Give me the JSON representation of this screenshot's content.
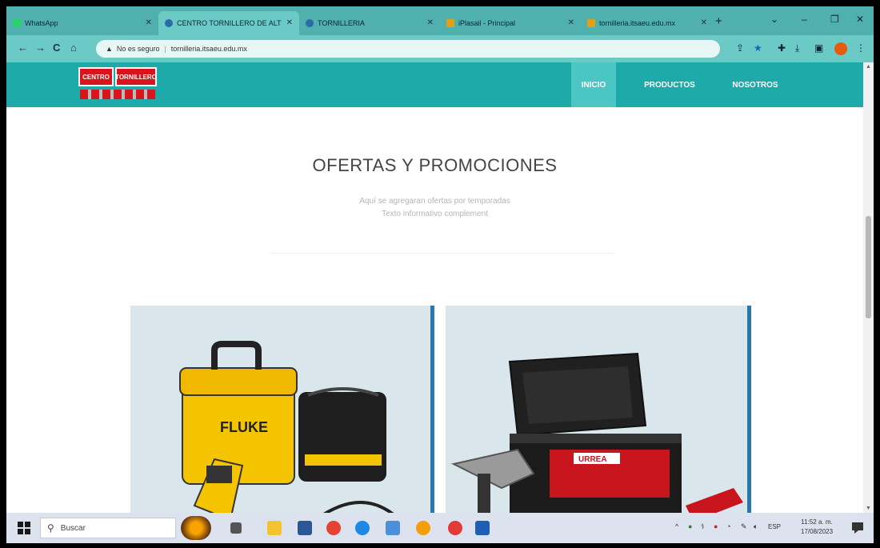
{
  "browser": {
    "tabs": [
      {
        "label": "WhatsApp",
        "color": "#25d366"
      },
      {
        "label": "CENTRO TORNILLERO DE ALT",
        "color": "#2a6ba8"
      },
      {
        "label": "TORNILLERIA",
        "color": "#2a6ba8"
      },
      {
        "label": "iPlasail - Principal",
        "color": "#e0a11b"
      },
      {
        "label": "tornilleria.itsaeu.edu.mx",
        "color": "#e0a11b"
      }
    ],
    "new_tab": "+",
    "window_controls": {
      "minimize": "–",
      "maximize": "❐",
      "close": "✕"
    },
    "nav": {
      "back": "←",
      "forward": "→",
      "reload": "C",
      "home": "⌂"
    },
    "address": {
      "security_label": "No es seguro",
      "url": "tornilleria.itsaeu.edu.mx"
    }
  },
  "site": {
    "logo": {
      "part1": "CENTRO",
      "part2": "TORNILLERO"
    },
    "nav": [
      {
        "label": "INICIO",
        "active": true
      },
      {
        "label": "PRODUCTOS",
        "active": false
      },
      {
        "label": "NOSOTROS",
        "active": false
      }
    ],
    "section": {
      "title": "OFERTAS Y PROMOCIONES",
      "line1": "Aquí se agregaran ofertas por temporadas",
      "line2": "Texto informativo complement"
    },
    "cards": [
      {
        "brand_text": "FLUKE"
      },
      {
        "brand_text": "URREA"
      }
    ]
  },
  "taskbar": {
    "search_placeholder": "Buscar",
    "tray_lang": "ESP",
    "time": "11:52 a. m.",
    "date": "17/08/2023"
  },
  "colors": {
    "nav_bg": "#1eaaa8",
    "nav_active": "#4cc6c4",
    "tab_bar": "#4fb0ae",
    "card_bg": "#d9e6ec",
    "card_border": "#2a78a8"
  }
}
